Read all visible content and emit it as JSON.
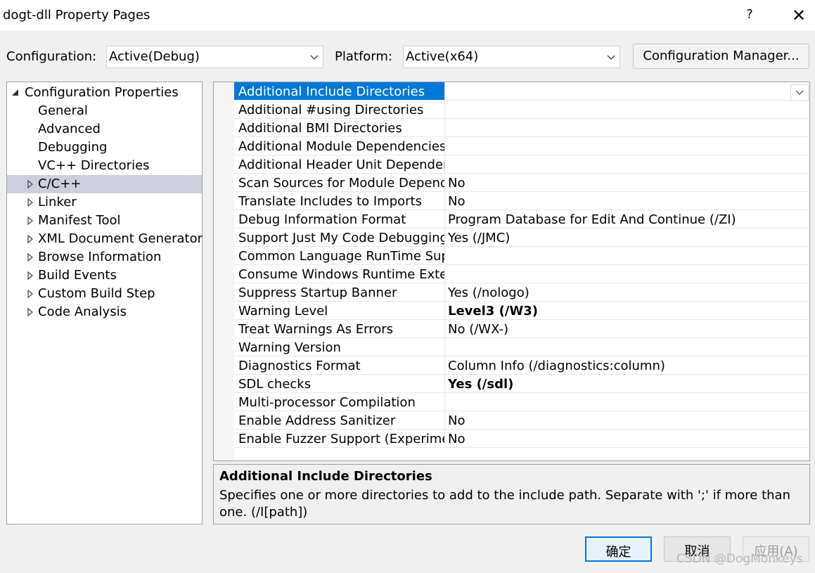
{
  "window": {
    "title": "dogt-dll Property Pages",
    "help_glyph": "?",
    "close_glyph": "✕"
  },
  "toolbar": {
    "configuration_label": "Configuration:",
    "configuration_value": "Active(Debug)",
    "platform_label": "Platform:",
    "platform_value": "Active(x64)",
    "config_manager_label": "Configuration Manager..."
  },
  "tree": {
    "root": "Configuration Properties",
    "items": [
      {
        "label": "General",
        "expandable": false
      },
      {
        "label": "Advanced",
        "expandable": false
      },
      {
        "label": "Debugging",
        "expandable": false
      },
      {
        "label": "VC++ Directories",
        "expandable": false
      },
      {
        "label": "C/C++",
        "expandable": true,
        "selected": true
      },
      {
        "label": "Linker",
        "expandable": true
      },
      {
        "label": "Manifest Tool",
        "expandable": true
      },
      {
        "label": "XML Document Generator",
        "expandable": true
      },
      {
        "label": "Browse Information",
        "expandable": true
      },
      {
        "label": "Build Events",
        "expandable": true
      },
      {
        "label": "Custom Build Step",
        "expandable": true
      },
      {
        "label": "Code Analysis",
        "expandable": true
      }
    ]
  },
  "properties": [
    {
      "name": "Additional Include Directories",
      "value": "",
      "selected": true
    },
    {
      "name": "Additional #using Directories",
      "value": ""
    },
    {
      "name": "Additional BMI Directories",
      "value": ""
    },
    {
      "name": "Additional Module Dependencies",
      "value": ""
    },
    {
      "name": "Additional Header Unit Dependencies",
      "value": ""
    },
    {
      "name": "Scan Sources for Module Dependencies",
      "value": "No"
    },
    {
      "name": "Translate Includes to Imports",
      "value": "No"
    },
    {
      "name": "Debug Information Format",
      "value": "Program Database for Edit And Continue (/ZI)"
    },
    {
      "name": "Support Just My Code Debugging",
      "value": "Yes (/JMC)"
    },
    {
      "name": "Common Language RunTime Support",
      "value": ""
    },
    {
      "name": "Consume Windows Runtime Extension",
      "value": ""
    },
    {
      "name": "Suppress Startup Banner",
      "value": "Yes (/nologo)"
    },
    {
      "name": "Warning Level",
      "value": "Level3 (/W3)",
      "bold": true
    },
    {
      "name": "Treat Warnings As Errors",
      "value": "No (/WX-)"
    },
    {
      "name": "Warning Version",
      "value": ""
    },
    {
      "name": "Diagnostics Format",
      "value": "Column Info (/diagnostics:column)"
    },
    {
      "name": "SDL checks",
      "value": "Yes (/sdl)",
      "bold": true
    },
    {
      "name": "Multi-processor Compilation",
      "value": ""
    },
    {
      "name": "Enable Address Sanitizer",
      "value": "No"
    },
    {
      "name": "Enable Fuzzer Support (Experimental)",
      "value": "No"
    }
  ],
  "description": {
    "title": "Additional Include Directories",
    "text": "Specifies one or more directories to add to the include path. Separate with ';' if more than one. (/I[path])"
  },
  "buttons": {
    "ok": "确定",
    "cancel": "取消",
    "apply": "应用(A)"
  },
  "watermark": "CSDN @DogMonkeys",
  "colors": {
    "selection_blue": "#0078d7",
    "tree_selection": "#cdd0dc",
    "ok_border": "#0078d7"
  }
}
